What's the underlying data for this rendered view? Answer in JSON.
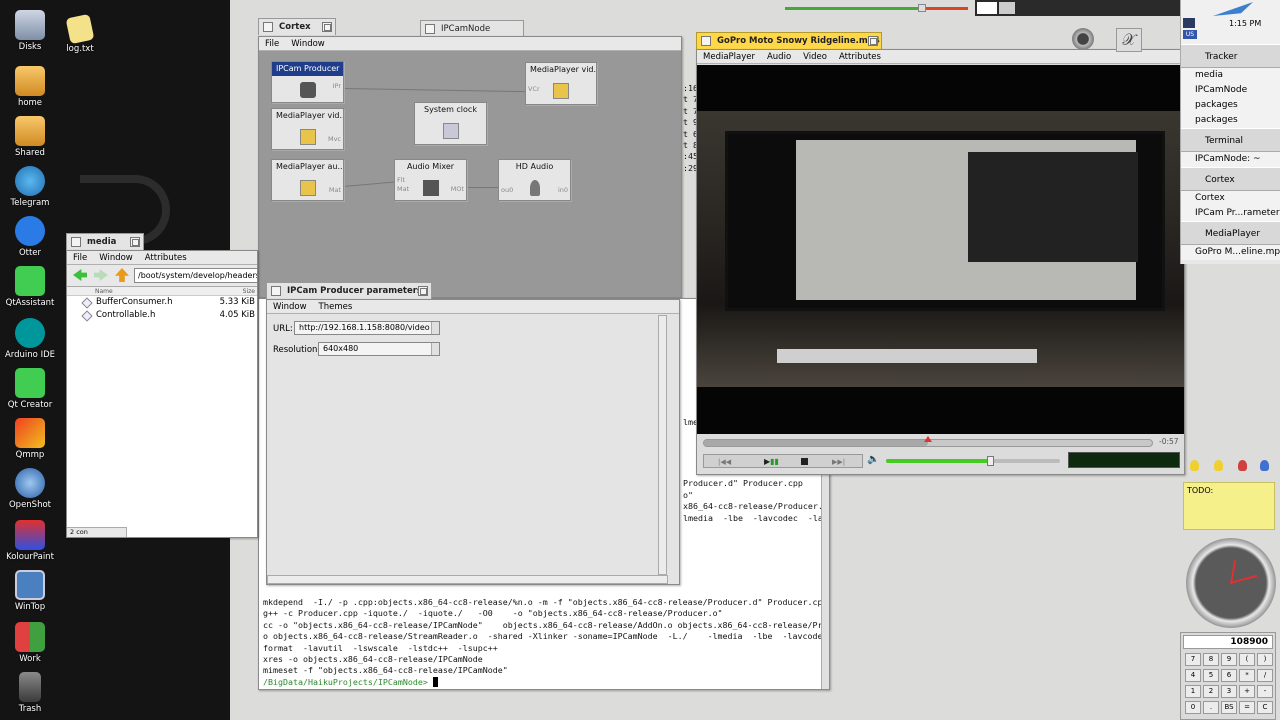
{
  "desktop": {
    "icons": [
      {
        "label": "Disks"
      },
      {
        "label": "log.txt"
      },
      {
        "label": "home"
      },
      {
        "label": "Shared"
      },
      {
        "label": "Telegram"
      },
      {
        "label": "Otter"
      },
      {
        "label": "QtAssistant"
      },
      {
        "label": "Arduino IDE"
      },
      {
        "label": "Qt Creator"
      },
      {
        "label": "Qmmp"
      },
      {
        "label": "OpenShot"
      },
      {
        "label": "KolourPaint"
      },
      {
        "label": "WinTop"
      },
      {
        "label": "Work"
      },
      {
        "label": "Trash"
      }
    ]
  },
  "colors": {
    "accent": "#ffd84a",
    "selection": "#1f3d8a",
    "progress": "#44cc22",
    "terminal_prompt": "#2a8a2a"
  },
  "cortex": {
    "tab_title": "Cortex",
    "second_tab_title": "IPCamNode",
    "menu": [
      "File",
      "Window"
    ],
    "nodes": [
      {
        "title": "IPCam Producer",
        "port_out": "IPr",
        "icon": "camera-icon"
      },
      {
        "title": "MediaPlayer vid...",
        "port_in": "VCr",
        "icon": "film-icon"
      },
      {
        "title": "MediaPlayer vid...",
        "port_out": "Mvc",
        "icon": "film-icon"
      },
      {
        "title": "System clock",
        "icon": "clock-icon"
      },
      {
        "title": "MediaPlayer au...",
        "port_out": "Mat",
        "icon": "film-icon"
      },
      {
        "title": "Audio Mixer",
        "port_in1": "Flt",
        "port_in2": "Mat",
        "port_out": "MOt",
        "icon": "mixer-icon"
      },
      {
        "title": "HD Audio",
        "port_in": "ou0",
        "port_out": "in0",
        "icon": "microphone-icon"
      }
    ]
  },
  "media": {
    "tab_title": "media",
    "menu": [
      "File",
      "Window",
      "Attributes"
    ],
    "path": "/boot/system/develop/headers/c",
    "columns": {
      "name": "Name",
      "size": "Size"
    },
    "files": [
      {
        "name": "BufferConsumer.h",
        "size": "5.33 KiB"
      },
      {
        "name": "Controllable.h",
        "size": "4.05 KiB"
      }
    ],
    "status": "2 con"
  },
  "params": {
    "tab_title": "IPCam Producer parameters",
    "menu": [
      "Window",
      "Themes"
    ],
    "url_label": "URL:",
    "url_value": "http://192.168.1.158:8080/video",
    "resolution_label": "Resolution:",
    "resolution_value": "640x480"
  },
  "terminal": {
    "side_fragments": [
      ":16",
      "t 7",
      "t 7",
      "t 9",
      "t 6",
      "t 8",
      ":45",
      ":29"
    ],
    "right_fragments": [
      "lmedia",
      "Producer.d\" Producer.cpp",
      "o\"",
      "x86_64-cc8-release/Producer.",
      "lmedia  -lbe  -lavcodec  -lav"
    ],
    "lines": [
      "mkdepend  -I./ -p .cpp:objects.x86_64-cc8-release/%n.o -m -f \"objects.x86_64-cc8-release/Producer.d\" Producer.cpp",
      "g++ -c Producer.cpp -iquote./  -iquote./   -O0    -o \"objects.x86_64-cc8-release/Producer.o\"",
      "cc -o \"objects.x86_64-cc8-release/IPCamNode\"    objects.x86_64-cc8-release/AddOn.o objects.x86_64-cc8-release/Producer.",
      "o objects.x86_64-cc8-release/StreamReader.o  -shared -Xlinker -soname=IPCamNode  -L./    -lmedia  -lbe  -lavcodec  -lav",
      "format  -lavutil  -lswscale  -lstdc++  -lsupc++",
      "xres -o objects.x86_64-cc8-release/IPCamNode",
      "mimeset -f \"objects.x86_64-cc8-release/IPCamNode\""
    ],
    "prompt": "/BigData/HaikuProjects/IPCamNode>"
  },
  "player": {
    "tab_title": "GoPro Moto Snowy Ridgeline.mp4",
    "menu": [
      "MediaPlayer",
      "Audio",
      "Video",
      "Attributes"
    ],
    "time_remaining": "-0:57",
    "playback_progress": 0.5,
    "volume_level": 0.6
  },
  "deskbar": {
    "clock": "1:15 PM",
    "locale": "US",
    "apps": [
      {
        "name": "Tracker",
        "windows": [
          "media",
          "IPCamNode",
          "packages",
          "packages"
        ]
      },
      {
        "name": "Terminal",
        "windows": [
          "IPCamNode: ~"
        ]
      },
      {
        "name": "Cortex",
        "windows": [
          "Cortex",
          "IPCam Pr...rameters"
        ]
      },
      {
        "name": "MediaPlayer",
        "windows": [
          "GoPro M...eline.mp4"
        ]
      }
    ]
  },
  "sticky": {
    "text": "TODO:"
  },
  "calculator": {
    "display": "108900",
    "keys": [
      "7",
      "8",
      "9",
      "(",
      ")",
      "4",
      "5",
      "6",
      "*",
      "/",
      "1",
      "2",
      "3",
      "+",
      "-",
      "0",
      ".",
      "BS",
      "=",
      "C"
    ]
  }
}
